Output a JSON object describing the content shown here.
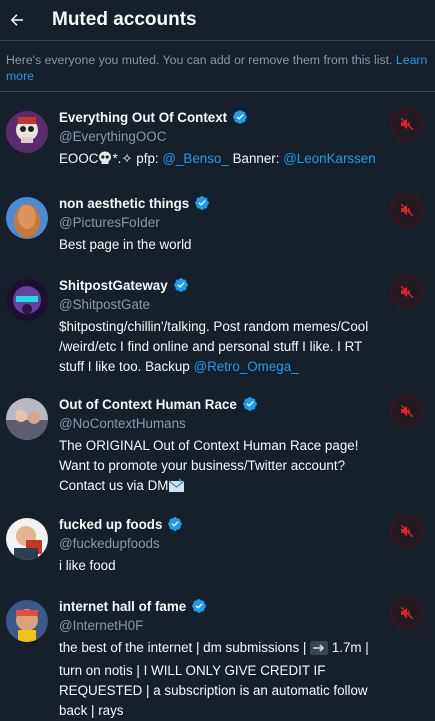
{
  "header": {
    "title": "Muted accounts"
  },
  "description": {
    "text": "Here's everyone you muted. You can add or remove them from this list. ",
    "link": "Learn more"
  },
  "accounts": [
    {
      "name": "Everything Out Of Context",
      "handle": "@EverythingOOC",
      "bio_parts": [
        "EOOC",
        "*.✧ pfp: ",
        "@_Benso_",
        " Banner: ",
        "@LeonKarssen"
      ]
    },
    {
      "name": "non aesthetic things",
      "handle": "@PicturesFoIder",
      "bio_parts": [
        "Best page in the world"
      ]
    },
    {
      "name": "ShitpostGateway",
      "handle": "@ShitpostGate",
      "bio_parts": [
        "$hitposting/chillin'/talking. Post random memes/Cool /weird/etc I find online and personal stuff I like. I RT stuff I like too. Backup ",
        "@Retro_Omega_"
      ]
    },
    {
      "name": "Out of Context Human Race",
      "handle": "@NoContextHumans",
      "bio_parts": [
        "The ORIGINAL Out of Context Human Race page! Want to promote your business/Twitter account? Contact us via DM"
      ]
    },
    {
      "name": "fucked up foods",
      "handle": "@fuckedupfoods",
      "bio_parts": [
        "i like food"
      ]
    },
    {
      "name": "internet hall of fame",
      "handle": "@InternetH0F",
      "bio_parts": [
        "the best of the internet | dm submissions | ",
        " 1.7m | turn on notis | I WILL ONLY GIVE CREDIT IF REQUESTED | a subscription is an automatic follow back | rays"
      ]
    }
  ],
  "colors": {
    "background": "#15202b",
    "link": "#1d9bf0",
    "secondary_text": "#8b98a5",
    "unmute_red": "#f4212e"
  },
  "icons": {
    "back": "arrow-left-icon",
    "verified": "verified-badge-icon",
    "unmute": "muted-speaker-icon"
  }
}
